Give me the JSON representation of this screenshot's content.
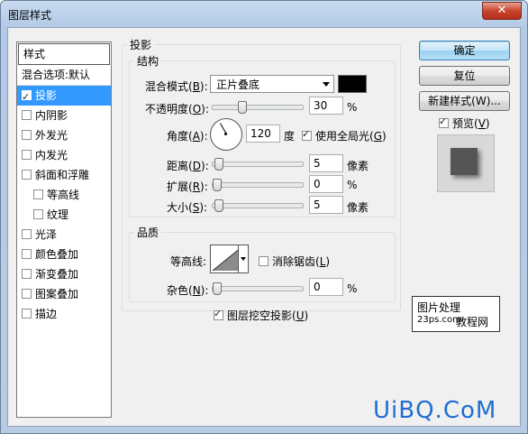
{
  "window": {
    "title": "图层样式",
    "close_glyph": "✕"
  },
  "styles": {
    "header": "样式",
    "items": [
      {
        "label": "混合选项:默认",
        "checkbox": false,
        "checked": false,
        "indent": false,
        "selected": false
      },
      {
        "label": "投影",
        "checkbox": true,
        "checked": true,
        "indent": false,
        "selected": true
      },
      {
        "label": "内阴影",
        "checkbox": true,
        "checked": false,
        "indent": false,
        "selected": false
      },
      {
        "label": "外发光",
        "checkbox": true,
        "checked": false,
        "indent": false,
        "selected": false
      },
      {
        "label": "内发光",
        "checkbox": true,
        "checked": false,
        "indent": false,
        "selected": false
      },
      {
        "label": "斜面和浮雕",
        "checkbox": true,
        "checked": false,
        "indent": false,
        "selected": false
      },
      {
        "label": "等高线",
        "checkbox": true,
        "checked": false,
        "indent": true,
        "selected": false
      },
      {
        "label": "纹理",
        "checkbox": true,
        "checked": false,
        "indent": true,
        "selected": false
      },
      {
        "label": "光泽",
        "checkbox": true,
        "checked": false,
        "indent": false,
        "selected": false
      },
      {
        "label": "颜色叠加",
        "checkbox": true,
        "checked": false,
        "indent": false,
        "selected": false
      },
      {
        "label": "渐变叠加",
        "checkbox": true,
        "checked": false,
        "indent": false,
        "selected": false
      },
      {
        "label": "图案叠加",
        "checkbox": true,
        "checked": false,
        "indent": false,
        "selected": false
      },
      {
        "label": "描边",
        "checkbox": true,
        "checked": false,
        "indent": false,
        "selected": false
      }
    ]
  },
  "shadow": {
    "title": "投影",
    "structure_title": "结构",
    "blend_label": "混合模式(",
    "blend_key": "B",
    "blend_tail": "):",
    "blend_value": "正片叠底",
    "shadow_color": "#000000",
    "opacity_label": "不透明度(",
    "opacity_key": "O",
    "opacity_tail": "):",
    "opacity_value": "30",
    "opacity_fraction": 0.3,
    "percent": "%",
    "angle_label": "角度(",
    "angle_key": "A",
    "angle_tail": "):",
    "angle_value": "120",
    "degree": "度",
    "global_light_label": "使用全局光(",
    "global_light_key": "G",
    "global_light_tail": ")",
    "global_light_checked": true,
    "distance_label": "距离(",
    "distance_key": "D",
    "distance_tail": "):",
    "distance_value": "5",
    "pixels": "像素",
    "spread_label": "扩展(",
    "spread_key": "R",
    "spread_tail": "):",
    "spread_value": "0",
    "size_label": "大小(",
    "size_key": "S",
    "size_tail": "):",
    "size_value": "5",
    "quality_title": "品质",
    "contour_label": "等高线:",
    "antialias_label": "消除锯齿(",
    "antialias_key": "L",
    "antialias_tail": ")",
    "antialias_checked": false,
    "noise_label": "杂色(",
    "noise_key": "N",
    "noise_tail": "):",
    "noise_value": "0",
    "knockout_label": "图层挖空投影(",
    "knockout_key": "U",
    "knockout_tail": ")",
    "knockout_checked": true
  },
  "buttons": {
    "ok": "确定",
    "reset": "复位",
    "new_style": "新建样式(W)...",
    "preview_label": "预览(",
    "preview_key": "V",
    "preview_tail": ")",
    "preview_checked": true
  },
  "watermarks": {
    "box_line1": "图片处理",
    "box_line2": "23ps.com",
    "box_line3": "教程网",
    "site": "UiBQ.CoM"
  }
}
